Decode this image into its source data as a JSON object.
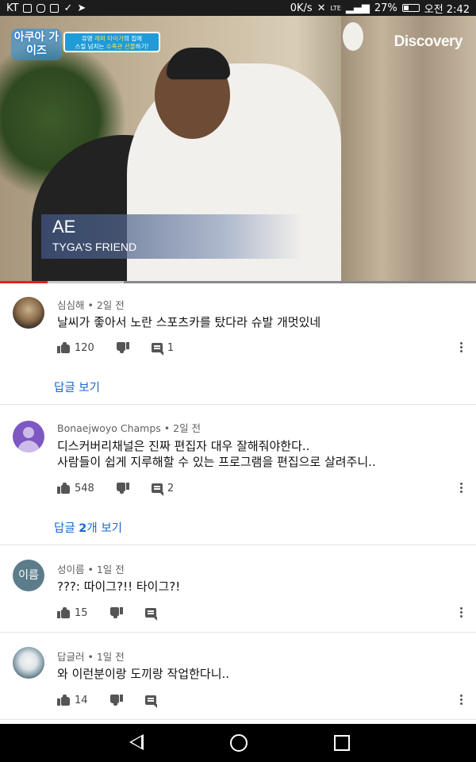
{
  "status_bar": {
    "carrier": "KT",
    "network_speed": "0K/s",
    "network_type": "LTE",
    "battery": "27%",
    "time": "오전 2:42"
  },
  "video": {
    "show_logo": "아쿠아 가이즈",
    "banner_line1_pre": "유명 ",
    "banner_line1_hl": "래퍼 타이가",
    "banner_line1_post": "의 집에",
    "banner_line2_pre": "스릴 넘치는 ",
    "banner_line2_hl": "수족관 선물",
    "banner_line2_post": "하기!",
    "channel_watermark": "Discovery",
    "caption_name": "AE",
    "caption_sub": "TYGA'S FRIEND",
    "progress_played": 0.1,
    "progress_buffered": 0.26
  },
  "comments": [
    {
      "author": "심심해",
      "age": "2일 전",
      "lines": [
        "날씨가 좋아서 노란 스포츠카를 탔다라 슈발 개멋있네"
      ],
      "likes": "120",
      "reply_count": "1",
      "replies_link": "답글 보기",
      "avatar": "photo"
    },
    {
      "author": "Bonaejwoyo Champs",
      "age": "2일 전",
      "lines": [
        "디스커버리채널은 진짜 편집자 대우 잘해줘야한다..",
        "사람들이 쉽게 지루해할 수 있는 프로그램을 편집으로 살려주니.."
      ],
      "likes": "548",
      "reply_count": "2",
      "replies_link_pre": "답글 ",
      "replies_link_num": "2",
      "replies_link_post": "개 보기",
      "avatar": "default-person"
    },
    {
      "author": "성이름",
      "age": "1일 전",
      "lines": [
        "???: 따이그?!! 타이그?!"
      ],
      "likes": "15",
      "avatar_text": "이름",
      "avatar": "text"
    },
    {
      "author": "답글러",
      "age": "1일 전",
      "lines": [
        "와 이런분이랑 도끼랑 작업한다니.."
      ],
      "likes": "14",
      "avatar": "bird"
    }
  ],
  "colors": {
    "accent_link": "#1a66d2",
    "progress_red": "#e52020",
    "text_primary": "#111111",
    "text_secondary": "#606060"
  }
}
